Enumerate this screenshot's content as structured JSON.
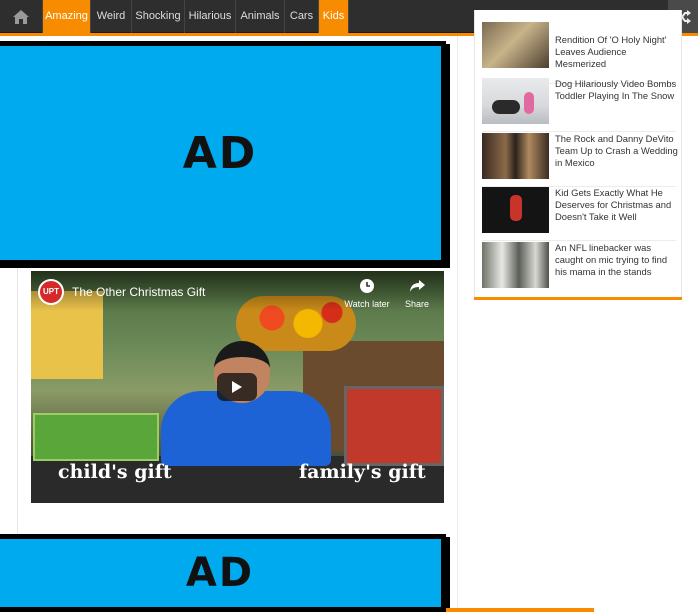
{
  "nav": {
    "items": [
      "Amazing",
      "Weird",
      "Shocking",
      "Hilarious",
      "Animals",
      "Cars",
      "Kids"
    ],
    "active": [
      "Amazing",
      "Kids"
    ],
    "home_icon": "home-icon",
    "shuffle_icon": "shuffle-icon",
    "accent_color": "#f88c00"
  },
  "ads": {
    "top_label": "AD",
    "bottom_label": "AD",
    "background": "#00aaee"
  },
  "video": {
    "channel_logo": "UPT",
    "title": "The Other Christmas Gift",
    "watch_later": "Watch later",
    "share": "Share",
    "caption_left": "child's gift",
    "caption_right": "family's gift"
  },
  "sidebar": {
    "posts": [
      {
        "title": "Rendition Of 'O Holy Night' Leaves Audience Mesmerized"
      },
      {
        "title": "Dog Hilariously Video Bombs Toddler Playing In The Snow"
      },
      {
        "title": "The Rock and Danny DeVito Team Up to Crash a Wedding in Mexico"
      },
      {
        "title": "Kid Gets Exactly What He Deserves for Christmas and Doesn't Take it Well"
      },
      {
        "title": "An NFL linebacker was caught on mic trying to find his mama in the stands"
      }
    ]
  }
}
